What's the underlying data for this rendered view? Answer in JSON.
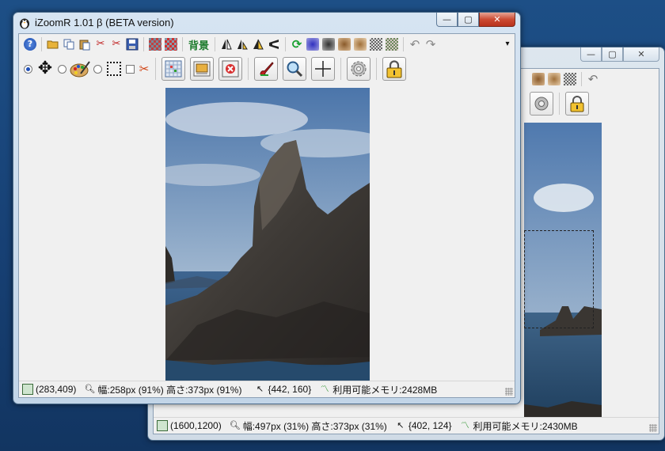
{
  "back_window": {
    "toolbar_text_undo": "↶",
    "status": {
      "pixel": "(1600,1200)",
      "size": "幅:497px (31%) 高さ:373px (31%)",
      "cursor": "{402, 124}",
      "memory": "利用可能メモリ:2430MB"
    }
  },
  "front_window": {
    "title": "iZoomR 1.01 β (BETA version)",
    "caption": {
      "minimize": "—",
      "maximize": "▢",
      "close": "✕"
    },
    "toolbar1": {
      "help": "?",
      "background_label": "背景",
      "undo": "↶",
      "redo": "↷",
      "overflow": "▾"
    },
    "status": {
      "pixel": "(283,409)",
      "size": "幅:258px (91%) 高さ:373px (91%)",
      "cursor": "{442, 160}",
      "memory": "利用可能メモリ:2428MB"
    }
  },
  "colors": {
    "desktop": "#174074",
    "title_active": "#c2d5e8",
    "close_red": "#cc4b33",
    "client_bg": "#f0f0f0",
    "bg_label_green": "#1a7a2a"
  }
}
